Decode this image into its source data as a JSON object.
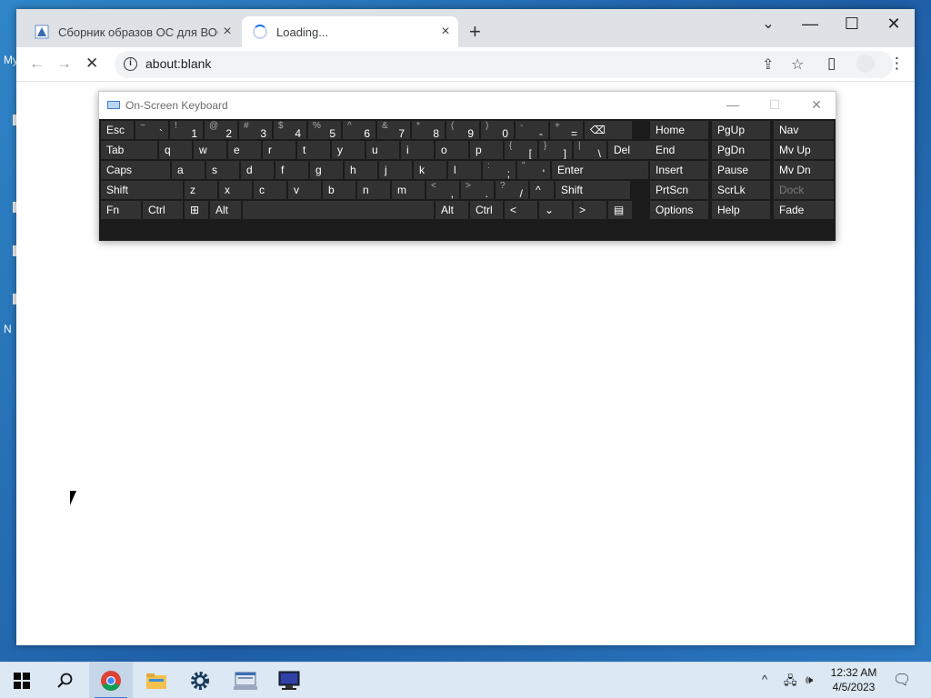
{
  "desktop": {
    "icon_labels": [
      "My",
      "N"
    ]
  },
  "browser": {
    "tabs": [
      {
        "title": "Сборник образов ОС для ВОСН",
        "close": "×"
      },
      {
        "title": "Loading...",
        "close": "×"
      }
    ],
    "new_tab": "+",
    "window_controls": {
      "minimize": "—",
      "maximize": "☐",
      "close": "✕",
      "menu": "⌄"
    },
    "nav": {
      "back": "←",
      "forward": "→",
      "stop": "✕"
    },
    "omnibox": {
      "info": "i",
      "url": "about:blank"
    }
  },
  "osk": {
    "title": "On-Screen Keyboard",
    "controls": {
      "minimize": "—",
      "maximize": "☐",
      "close": "✕"
    },
    "rows": [
      [
        {
          "l": "Esc"
        },
        {
          "s": "~",
          "m": "`"
        },
        {
          "s": "!",
          "m": "1"
        },
        {
          "s": "@",
          "m": "2"
        },
        {
          "s": "#",
          "m": "3"
        },
        {
          "s": "$",
          "m": "4"
        },
        {
          "s": "%",
          "m": "5"
        },
        {
          "s": "^",
          "m": "6"
        },
        {
          "s": "&",
          "m": "7"
        },
        {
          "s": "*",
          "m": "8"
        },
        {
          "s": "(",
          "m": "9"
        },
        {
          "s": ")",
          "m": "0"
        },
        {
          "s": "-",
          "m": "-"
        },
        {
          "s": "+",
          "m": "="
        },
        {
          "l": "⌫"
        }
      ],
      [
        {
          "l": "Tab"
        },
        {
          "l": "q"
        },
        {
          "l": "w"
        },
        {
          "l": "e"
        },
        {
          "l": "r"
        },
        {
          "l": "t"
        },
        {
          "l": "y"
        },
        {
          "l": "u"
        },
        {
          "l": "i"
        },
        {
          "l": "o"
        },
        {
          "l": "p"
        },
        {
          "s": "{",
          "m": "["
        },
        {
          "s": "}",
          "m": "]"
        },
        {
          "s": "|",
          "m": "\\"
        },
        {
          "l": "Del"
        }
      ],
      [
        {
          "l": "Caps"
        },
        {
          "l": "a"
        },
        {
          "l": "s"
        },
        {
          "l": "d"
        },
        {
          "l": "f"
        },
        {
          "l": "g"
        },
        {
          "l": "h"
        },
        {
          "l": "j"
        },
        {
          "l": "k"
        },
        {
          "l": "l"
        },
        {
          "s": ":",
          "m": ";"
        },
        {
          "s": "\"",
          "m": "'"
        },
        {
          "l": "Enter"
        }
      ],
      [
        {
          "l": "Shift"
        },
        {
          "l": "z"
        },
        {
          "l": "x"
        },
        {
          "l": "c"
        },
        {
          "l": "v"
        },
        {
          "l": "b"
        },
        {
          "l": "n"
        },
        {
          "l": "m"
        },
        {
          "s": "<",
          "m": ","
        },
        {
          "s": ">",
          "m": "."
        },
        {
          "s": "?",
          "m": "/"
        },
        {
          "l": "^"
        },
        {
          "l": "Shift"
        }
      ],
      [
        {
          "l": "Fn"
        },
        {
          "l": "Ctrl"
        },
        {
          "l": "⊞"
        },
        {
          "l": "Alt"
        },
        {
          "l": ""
        },
        {
          "l": "Alt"
        },
        {
          "l": "Ctrl"
        },
        {
          "l": "<"
        },
        {
          "l": "⌄"
        },
        {
          "l": ">"
        },
        {
          "l": "▤"
        }
      ]
    ],
    "nav_keys": [
      [
        "Home",
        "PgUp",
        "Nav"
      ],
      [
        "End",
        "PgDn",
        "Mv Up"
      ],
      [
        "Insert",
        "Pause",
        "Mv Dn"
      ],
      [
        "PrtScn",
        "ScrLk",
        "Dock"
      ],
      [
        "Options",
        "Help",
        "Fade"
      ]
    ]
  },
  "taskbar": {
    "apps": [
      "start",
      "search",
      "chrome",
      "file-explorer",
      "settings",
      "app",
      "computer"
    ],
    "tray": {
      "chevron": "^",
      "time": "12:32 AM",
      "date": "4/5/2023"
    }
  }
}
